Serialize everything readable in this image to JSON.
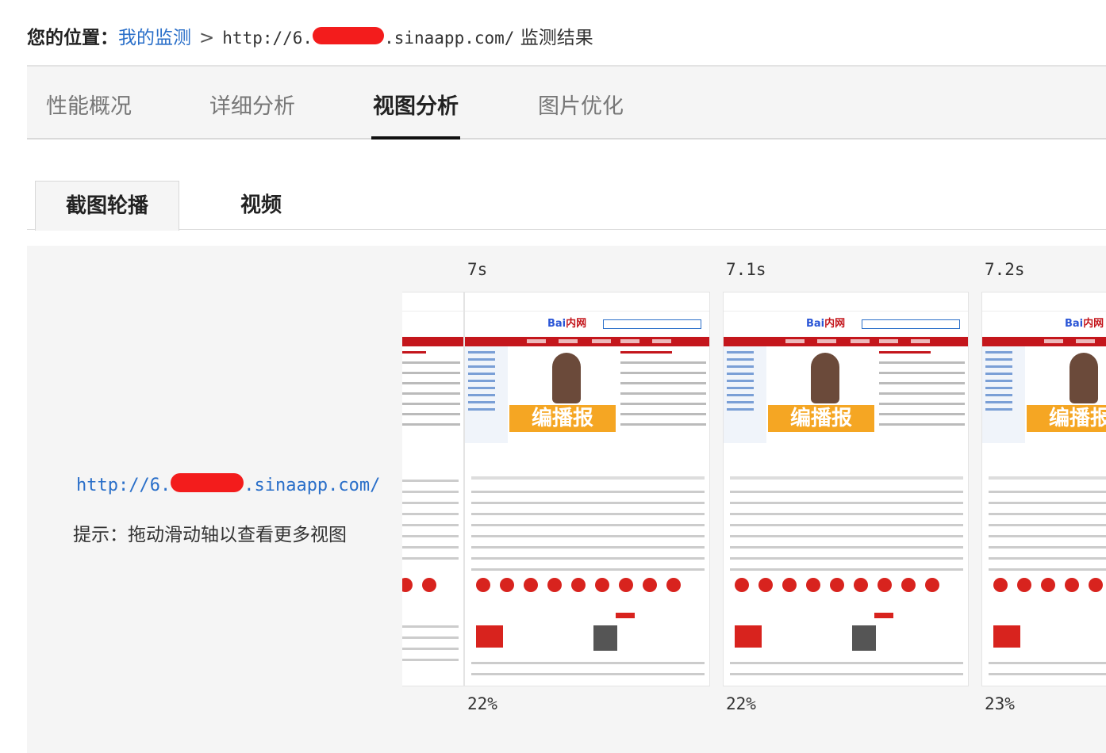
{
  "breadcrumb": {
    "label": "您的位置：",
    "link": "我的监测",
    "sep": ">",
    "url_prefix": "http://6.",
    "url_suffix": ".sinaapp.com/",
    "current": "监测结果"
  },
  "main_tabs": [
    {
      "label": "性能概况",
      "active": false
    },
    {
      "label": "详细分析",
      "active": false
    },
    {
      "label": "视图分析",
      "active": true
    },
    {
      "label": "图片优化",
      "active": false
    }
  ],
  "sub_tabs": [
    {
      "label": "截图轮播",
      "active": true
    },
    {
      "label": "视频",
      "active": false
    }
  ],
  "panel": {
    "url_prefix": "http://6.",
    "url_suffix": ".sinaapp.com/",
    "hint": "提示：拖动滑动轴以查看更多视图"
  },
  "frames": [
    {
      "time": "7s",
      "percent": "22%"
    },
    {
      "time": "7.1s",
      "percent": "22%"
    },
    {
      "time": "7.2s",
      "percent": "23%"
    }
  ],
  "thumbnail": {
    "logo_text": "Bai",
    "logo_suffix": "内网",
    "banner_text": "编播报"
  },
  "colors": {
    "link": "#2a6fc9",
    "redaction": "#f31c1c",
    "brand_red": "#c4161c"
  }
}
